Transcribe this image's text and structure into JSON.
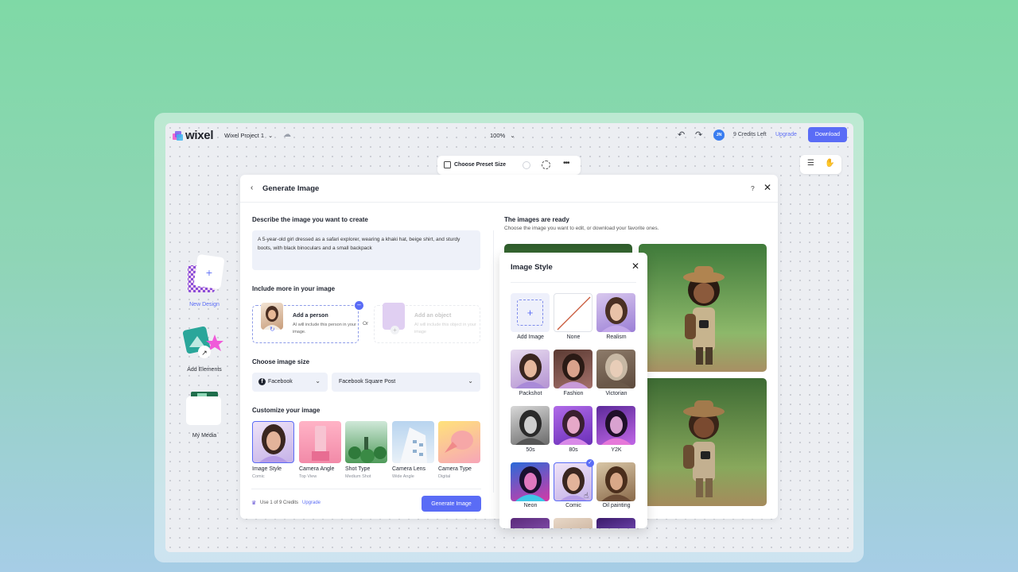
{
  "app": {
    "brand": "wixel",
    "project_name": "Wixel Project 1",
    "zoom": "100%",
    "avatar_initials": "JN",
    "credits": "9 Credits Left",
    "upgrade": "Upgrade",
    "download": "Download"
  },
  "toolbar": {
    "preset_label": "Choose Preset Size"
  },
  "sidebar": {
    "items": [
      {
        "label": "New Design"
      },
      {
        "label": "Add Elements"
      },
      {
        "label": "My Media"
      }
    ]
  },
  "dialog": {
    "title": "Generate Image",
    "help": "?",
    "describe_title": "Describe the image you want to create",
    "prompt": "A 5-year-old girl dressed as a safari explorer, wearing a khaki hat, beige shirt, and sturdy boots, with black binoculars and a small backpack",
    "include_title": "Include more in your image",
    "include": [
      {
        "title": "Add a person",
        "desc": "AI will include this person in your image."
      },
      {
        "title": "Add an object",
        "desc": "AI will include this object in your image"
      }
    ],
    "or": "Or",
    "size_title": "Choose image size",
    "size_platform": "Facebook",
    "size_format": "Facebook Square Post",
    "customize_title": "Customize your image",
    "customize": [
      {
        "label": "Image Style",
        "sub": "Comic"
      },
      {
        "label": "Camera Angle",
        "sub": "Top View"
      },
      {
        "label": "Shot Type",
        "sub": "Medium Shot"
      },
      {
        "label": "Camera Lens",
        "sub": "Wide Angle"
      },
      {
        "label": "Camera Type",
        "sub": "Digital"
      }
    ],
    "credit_note": "Use 1 of 9 Credits",
    "credit_upgrade": "Upgrade",
    "generate": "Generate Image",
    "results_title": "The images are ready",
    "results_sub": "Choose the image you want to edit, or download your favorite ones."
  },
  "style_panel": {
    "title": "Image Style",
    "styles": [
      {
        "label": "Add Image"
      },
      {
        "label": "None"
      },
      {
        "label": "Realism"
      },
      {
        "label": "Packshot"
      },
      {
        "label": "Fashion"
      },
      {
        "label": "Victorian"
      },
      {
        "label": "50s"
      },
      {
        "label": "80s"
      },
      {
        "label": "Y2K"
      },
      {
        "label": "Neon"
      },
      {
        "label": "Comic"
      },
      {
        "label": "Oil painting"
      }
    ],
    "selected": "Comic"
  },
  "colors": {
    "accent": "#5a6cf6",
    "background_top": "#7fd9a6",
    "background_bottom": "#a6cde6"
  }
}
